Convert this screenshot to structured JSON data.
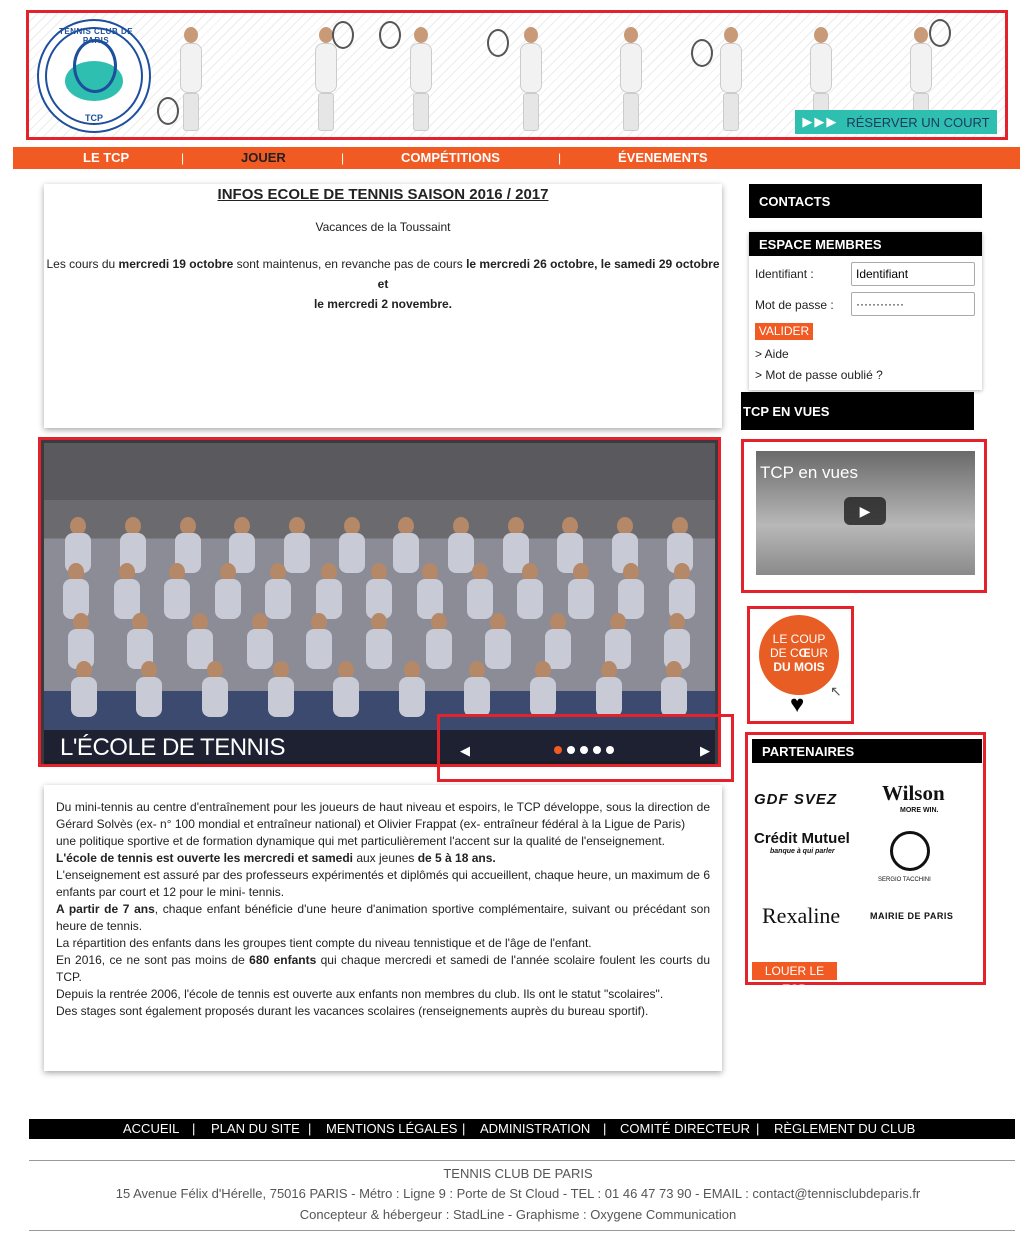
{
  "header": {
    "logo_text": "TENNIS CLUB DE PARIS",
    "logo_abbr": "TCP",
    "reserve_label": "RÉSERVER UN COURT"
  },
  "nav": {
    "items": [
      "LE TCP",
      "JOUER",
      "COMPÉTITIONS",
      "ÉVENEMENTS"
    ],
    "active": "JOUER",
    "separator": "|"
  },
  "info": {
    "title": "INFOS ECOLE DE TENNIS SAISON 2016 / 2017",
    "subtitle": "Vacances de la Toussaint",
    "line1_a": "Les cours du ",
    "line1_b": "mercredi 19 octobre",
    "line1_c": " sont maintenus, en revanche pas de cours ",
    "line1_d": "le mercredi 26 octobre, le samedi 29 octobre et",
    "line2": "le mercredi 2 novembre."
  },
  "slider": {
    "caption": "L'ÉCOLE DE TENNIS",
    "prev_icon": "arrow-left-icon",
    "next_icon": "arrow-right-icon",
    "prev_glyph": "◀",
    "next_glyph": "▶",
    "slide_count": 5,
    "active_slide": 1
  },
  "article": {
    "p1": "Du mini-tennis au centre d'entraînement pour les joueurs de haut niveau et espoirs, le TCP développe, sous la direction de Gérard Solvès (ex- n° 100 mondial et entraîneur national) et Olivier Frappat (ex- entraîneur fédéral à la Ligue de Paris)",
    "p2": "une politique sportive et de formation dynamique qui met particulièrement l'accent sur la qualité de l'enseignement.",
    "p3_bold": "L'école de tennis est ouverte les mercredi et samedi",
    "p3_rest": " aux jeunes ",
    "p3_bold2": "de 5 à 18 ans.",
    "p4": "L'enseignement est assuré par des professeurs expérimentés et diplômés qui accueillent, chaque heure, un maximum de 6 enfants par court et 12 pour le mini- tennis.",
    "p5_bold": "A partir de 7 ans",
    "p5_rest": ", chaque enfant bénéficie d'une heure d'animation sportive complémentaire, suivant ou précédant son heure de tennis.",
    "p6": "La répartition des enfants dans les groupes tient compte du niveau tennistique et de l'âge de l'enfant.",
    "p7_a": "En 2016, ce ne sont pas moins de ",
    "p7_bold": "680 enfants",
    "p7_b": " qui chaque mercredi et samedi de l'année scolaire foulent les courts du TCP.",
    "p8": "Depuis la rentrée 2006, l'école de tennis est ouverte aux enfants non membres du club. Ils ont le statut \"scolaires\".",
    "p9": "Des stages sont également proposés durant les vacances scolaires (renseignements auprès du bureau sportif)."
  },
  "sidebar": {
    "contacts": "CONTACTS",
    "members": {
      "title": "ESPACE MEMBRES",
      "id_label": "Identifiant :",
      "id_value": "Identifiant",
      "pwd_label": "Mot de passe :",
      "pwd_value": "············",
      "validate": "VALIDER",
      "help": "> Aide",
      "forgot": "> Mot de passe oublié ?"
    },
    "vues_title": "TCP EN VUES",
    "video_title": "TCP en vues",
    "coeur": {
      "line1": "LE COUP",
      "line2a": "DE C",
      "line2b": "Œ",
      "line2c": "UR",
      "line3": "DU MOIS"
    },
    "partners": {
      "title": "PARTENAIRES",
      "logos": [
        "GDF SVEZ",
        "Wilson",
        "MORE WIN.",
        "Crédit Mutuel",
        "banque à qui parler",
        "SERGIO TACCHINI",
        "Rexaline",
        "MAIRIE DE PARIS"
      ],
      "louer": "LOUER LE TCP"
    }
  },
  "footer": {
    "links": [
      "ACCUEIL",
      "PLAN DU SITE",
      "MENTIONS LÉGALES",
      "ADMINISTRATION",
      "COMITÉ DIRECTEUR",
      "RÈGLEMENT DU CLUB"
    ],
    "club_name": "TENNIS CLUB DE PARIS",
    "address": "15 Avenue Félix d'Hérelle, 75016 PARIS - Métro : Ligne 9 : Porte de St Cloud - TEL : 01 46 47 73 90 - EMAIL : contact@tennisclubdeparis.fr",
    "credits": "Concepteur & hébergeur : StadLine - Graphisme : Oxygene Communication"
  },
  "colors": {
    "accent": "#f15a22",
    "teal": "#2fbfb0",
    "highlight": "#e3222b",
    "brand_blue": "#1d4f9c"
  }
}
